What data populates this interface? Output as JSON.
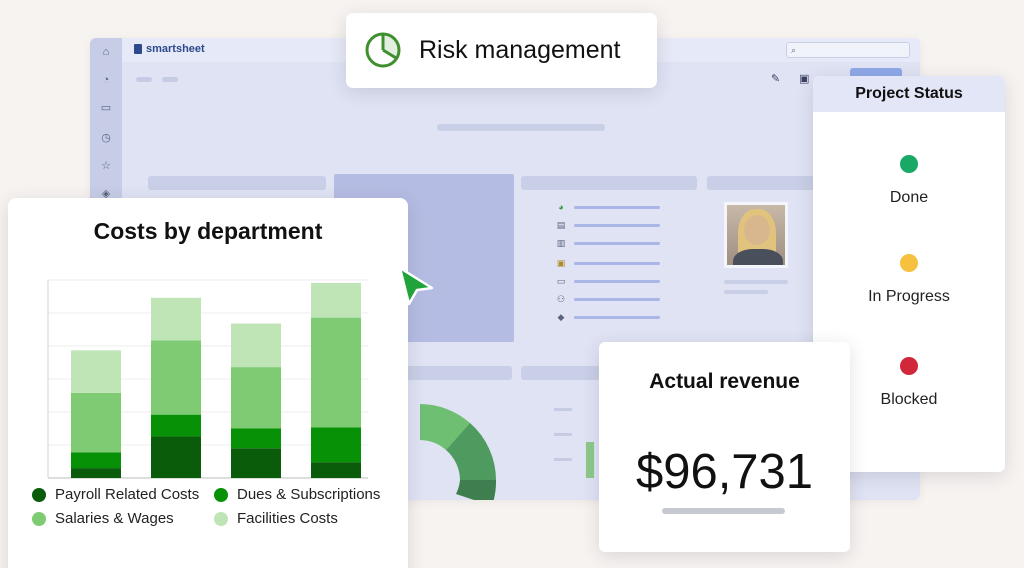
{
  "app": {
    "logo_text": "smartsheet",
    "search_icon_glyph": "⌕",
    "rail_icons": [
      "home-icon",
      "bell-icon",
      "folder-icon",
      "clock-icon",
      "star-icon",
      "apps-icon"
    ]
  },
  "risk_card": {
    "title": "Risk management",
    "icon": "pie-chart-icon",
    "accent": "#3f8f2f"
  },
  "costs_card": {
    "title": "Costs by department"
  },
  "chart_data": {
    "type": "bar",
    "stacked": true,
    "title": "Costs by department",
    "categories": [
      "",
      "",
      "",
      ""
    ],
    "series": [
      {
        "name": "Payroll Related Costs",
        "color": "#0a5c0a",
        "values": [
          10,
          42,
          30,
          16
        ]
      },
      {
        "name": "Dues & Subscriptions",
        "color": "#079107",
        "values": [
          16,
          22,
          20,
          35
        ]
      },
      {
        "name": "Salaries & Wages",
        "color": "#7ecb73",
        "values": [
          60,
          75,
          62,
          111
        ]
      },
      {
        "name": "Facilities Costs",
        "color": "#bfe4b6",
        "values": [
          43,
          43,
          44,
          35
        ]
      }
    ],
    "ylim": [
      0,
      200
    ],
    "grid": true,
    "legend": "bottom"
  },
  "status_card": {
    "title": "Project Status",
    "items": [
      {
        "label": "Done",
        "color": "#1aa866"
      },
      {
        "label": "In Progress",
        "color": "#f5c13e"
      },
      {
        "label": "Blocked",
        "color": "#d0283a"
      }
    ]
  },
  "revenue_card": {
    "title": "Actual revenue",
    "value": "$96,731"
  },
  "cursor": {
    "color": "#1fa33a",
    "icon": "pointer-cursor-icon"
  }
}
